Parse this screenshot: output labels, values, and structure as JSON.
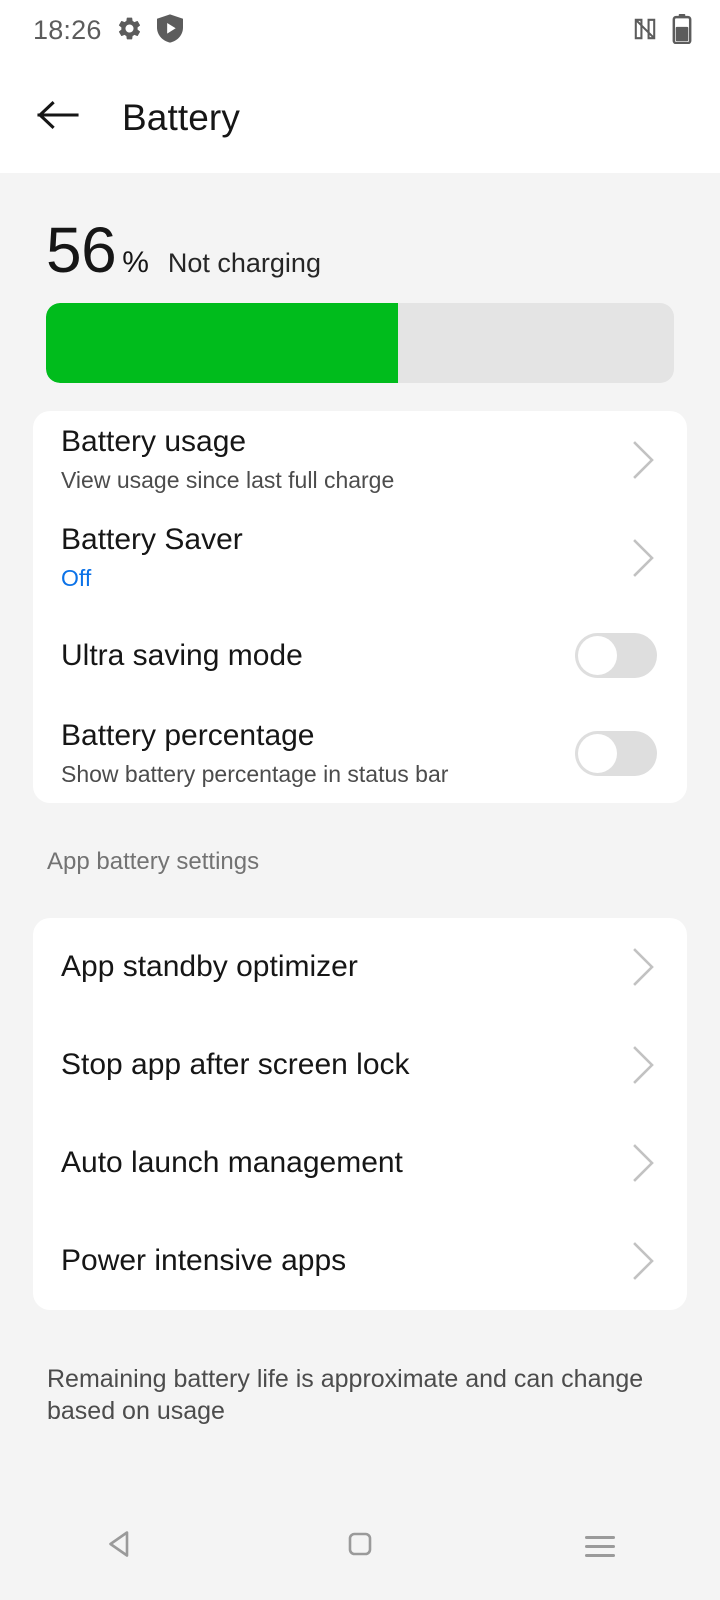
{
  "status_bar": {
    "time": "18:26",
    "left_icons": [
      "gear-icon",
      "play-protect-shield-icon"
    ],
    "right_icons": [
      "nfc-icon",
      "battery-icon"
    ]
  },
  "app_bar": {
    "back_icon": "back-arrow-icon",
    "title": "Battery"
  },
  "summary": {
    "percent": "56",
    "percent_symbol": "%",
    "charge_state": "Not charging",
    "fill_percent": 56,
    "fill_color": "#00bc1c",
    "track_color": "#e4e4e4"
  },
  "main_card": {
    "rows": [
      {
        "title": "Battery usage",
        "subtitle": "View usage since last full charge",
        "control": "chevron"
      },
      {
        "title": "Battery Saver",
        "subtitle": "Off",
        "subtitle_color": "#0b72e8",
        "control": "chevron"
      },
      {
        "title": "Ultra saving mode",
        "subtitle": "",
        "control": "toggle",
        "toggle_state": "off"
      },
      {
        "title": "Battery percentage",
        "subtitle": "Show battery percentage in status bar",
        "control": "toggle",
        "toggle_state": "off"
      }
    ]
  },
  "app_section": {
    "label": "App battery settings",
    "rows": [
      {
        "title": "App standby optimizer",
        "control": "chevron"
      },
      {
        "title": "Stop app after screen lock",
        "control": "chevron"
      },
      {
        "title": "Auto launch management",
        "control": "chevron"
      },
      {
        "title": "Power intensive apps",
        "control": "chevron"
      }
    ]
  },
  "footnote": "Remaining battery life is approximate and can change based on usage",
  "nav_bar": {
    "back": "nav-back-icon",
    "home": "nav-home-icon",
    "recents": "nav-recents-icon"
  }
}
